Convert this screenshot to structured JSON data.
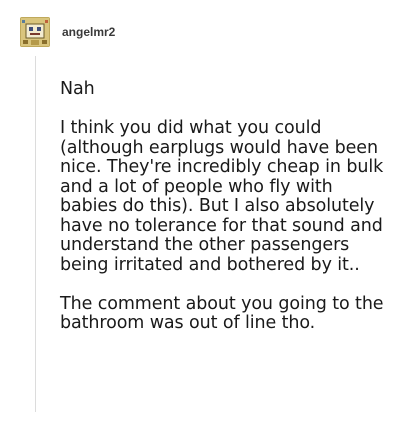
{
  "post": {
    "username": "angelmr2",
    "avatar_icon": "decorative-square-avatar-icon",
    "paragraphs": [
      "Nah",
      "I think you did what you could (although earplugs would have been nice. They're incredibly cheap in bulk and a lot of people who fly with babies do this). But I also absolutely have no tolerance for that sound and understand the other passengers being irritated and bothered by it..",
      "The comment about you going to the bathroom was out of line tho."
    ]
  },
  "colors": {
    "text": "#1a1a1a",
    "username": "#3a3a3a",
    "thread_line": "#dcdcdc",
    "avatar_bg": "#d6c27a"
  }
}
